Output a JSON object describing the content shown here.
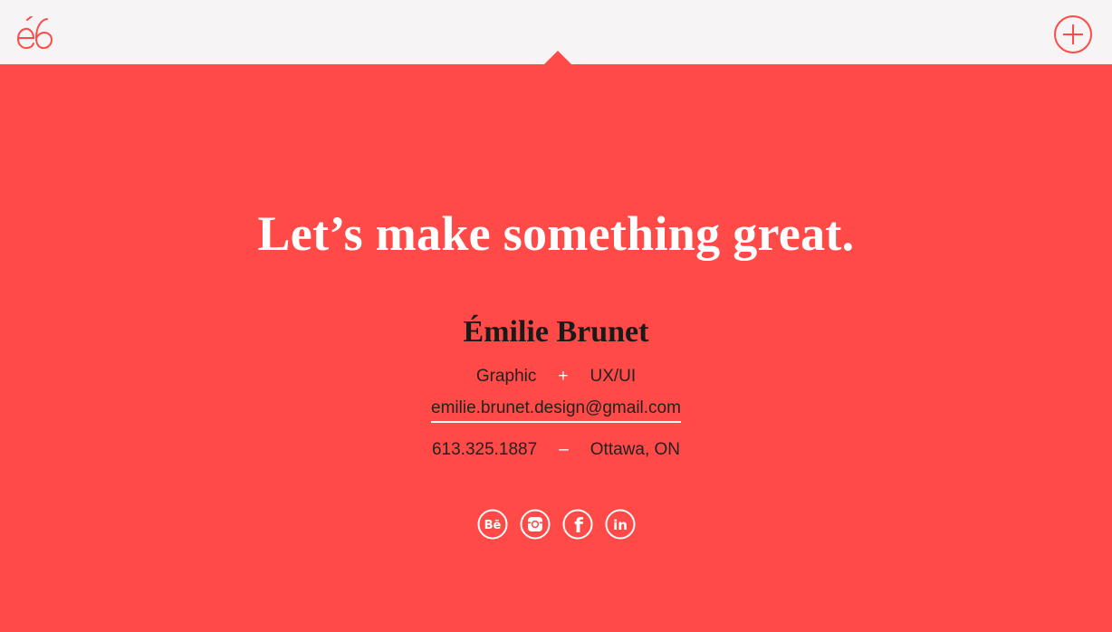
{
  "header": {
    "logo_icon": "eb-monogram-logo",
    "menu_icon": "plus-circle-icon"
  },
  "colors": {
    "accent": "#ff4a47",
    "header_bg": "#f6f4f5",
    "headline": "#ffffff",
    "body_text": "#222222"
  },
  "hero": {
    "headline": "Let’s make something great.",
    "name": "Émilie Brunet",
    "roles": {
      "first": "Graphic",
      "separator": "+",
      "second": "UX/UI"
    },
    "email": "emilie.brunet.design@gmail.com",
    "contact": {
      "phone": "613.325.1887",
      "separator": "–",
      "location": "Ottawa, ON"
    }
  },
  "socials": [
    {
      "icon": "behance-icon",
      "label": "Bē"
    },
    {
      "icon": "instagram-icon"
    },
    {
      "icon": "facebook-icon",
      "label": "f"
    },
    {
      "icon": "linkedin-icon",
      "label": "in"
    }
  ]
}
